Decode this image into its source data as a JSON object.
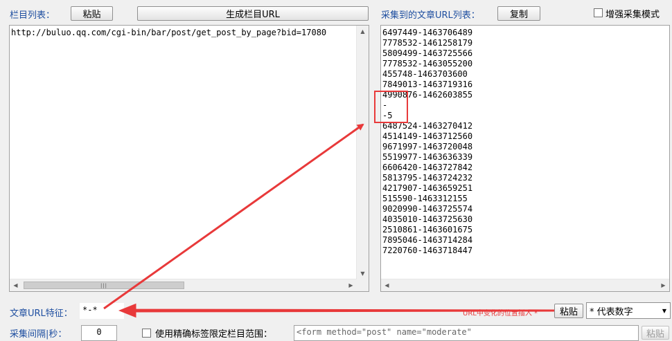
{
  "left": {
    "label": "栏目列表：",
    "paste_label": "粘贴",
    "generate_label": "生成栏目URL",
    "content": "http://buluo.qq.com/cgi-bin/bar/post/get_post_by_page?bid=17080"
  },
  "right": {
    "label": "采集到的文章URL列表：",
    "copy_label": "复制",
    "enhanced_label": "增强采集模式",
    "lines": [
      "6497449-1463706489",
      "7778532-1461258179",
      "5809499-1463725566",
      "7778532-1463055200",
      "455748-1463703600",
      "7849013-1463719316",
      "4990876-1462603855",
      "-",
      "-5",
      "6487524-1463270412",
      "4514149-1463712560",
      "9671997-1463720048",
      "5519977-1463636339",
      "6606420-1463727842",
      "5813795-1463724232",
      "4217907-1463659251",
      "515590-1463312155",
      "9020990-1463725574",
      "4035010-1463725630",
      "2510861-1463601675",
      "7895046-1463714284",
      "7220760-1463718447"
    ]
  },
  "feature": {
    "label": "文章URL特征：",
    "value": "*-*",
    "hint": "URL中变化的位置插入 *",
    "paste_label": "粘贴",
    "select_value": "* 代表数字"
  },
  "bottom": {
    "interval_label": "采集间隔|秒：",
    "interval_value": "0",
    "precise_label": "使用精确标签限定栏目范围：",
    "tag_value": "<form method=\"post\" name=\"moderate\"",
    "paste_label": "粘贴"
  },
  "colors": {
    "accent": "#1f4fa0",
    "annotation": "#e8393a"
  }
}
